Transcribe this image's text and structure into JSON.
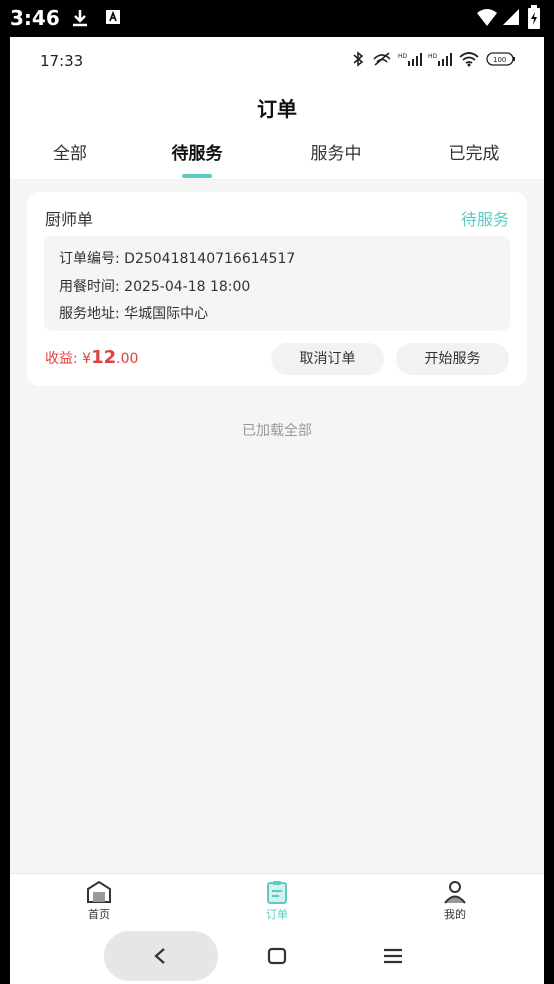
{
  "device": {
    "time": "3:46"
  },
  "status": {
    "time": "17:33",
    "battery": "100"
  },
  "header": {
    "title": "订单"
  },
  "tabs": [
    {
      "label": "全部"
    },
    {
      "label": "待服务"
    },
    {
      "label": "服务中"
    },
    {
      "label": "已完成"
    }
  ],
  "order": {
    "type": "厨师单",
    "status": "待服务",
    "number_label": "订单编号:",
    "number_value": "D250418140716614517",
    "time_label": "用餐时间:",
    "time_value": "2025-04-18 18:00",
    "address_label": "服务地址:",
    "address_value": "华城国际中心",
    "earn_label": "收益:",
    "earn_currency": "¥",
    "earn_int": "12",
    "earn_dec": ".00",
    "cancel_label": "取消订单",
    "start_label": "开始服务"
  },
  "list": {
    "end_text": "已加载全部"
  },
  "bottom_nav": [
    {
      "label": "首页"
    },
    {
      "label": "订单"
    },
    {
      "label": "我的"
    }
  ],
  "colors": {
    "accent": "#5ccbc4",
    "earn": "#e04040"
  }
}
